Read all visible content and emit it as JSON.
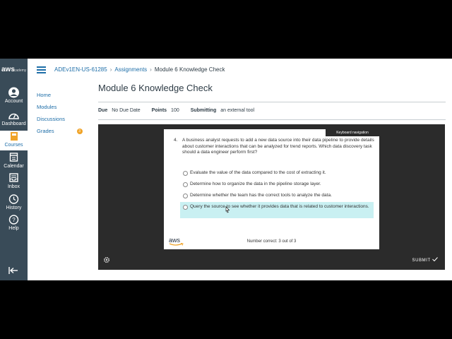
{
  "global_nav": {
    "logo_text": "aws",
    "logo_sub": "academy",
    "items": [
      {
        "label": "Account",
        "icon": "account-icon"
      },
      {
        "label": "Dashboard",
        "icon": "dashboard-icon"
      },
      {
        "label": "Courses",
        "icon": "courses-icon",
        "active": true
      },
      {
        "label": "Calendar",
        "icon": "calendar-icon"
      },
      {
        "label": "Inbox",
        "icon": "inbox-icon"
      },
      {
        "label": "History",
        "icon": "history-icon"
      },
      {
        "label": "Help",
        "icon": "help-icon"
      }
    ]
  },
  "breadcrumb": {
    "course": "ADEv1EN-US-61285",
    "section": "Assignments",
    "page": "Module 6 Knowledge Check"
  },
  "course_nav": {
    "items": [
      "Home",
      "Modules",
      "Discussions",
      "Grades"
    ],
    "grades_badge": "3"
  },
  "page": {
    "title": "Module 6 Knowledge Check",
    "due_label": "Due",
    "due_value": "No Due Date",
    "points_label": "Points",
    "points_value": "100",
    "submitting_label": "Submitting",
    "submitting_value": "an external tool"
  },
  "quiz": {
    "keyboard_nav": "Keyboard navigation",
    "number": "4.",
    "question": "A business analyst requests to add a new data source into their data pipeline to provide details about customer interactions that can be analyzed for trend reports. Which data discovery task should a data engineer perform first?",
    "options": [
      "Evaluate the value of the data compared to the cost of extracting it.",
      "Determine how to organize the data in the pipeline storage layer.",
      "Determine whether the team has the correct tools to analyze the data.",
      "Query the source to see whether it provides data that is related to customer interactions."
    ],
    "selected_index": 3,
    "logo": "aws",
    "score": "Number correct: 3 out of 3",
    "submit": "SUBMIT"
  },
  "colors": {
    "nav_bg": "#394b58",
    "link": "#1e6ea8",
    "selected_option": "#c9f0f2",
    "tool_bg": "#2b2b2b",
    "badge": "#f0a327"
  }
}
